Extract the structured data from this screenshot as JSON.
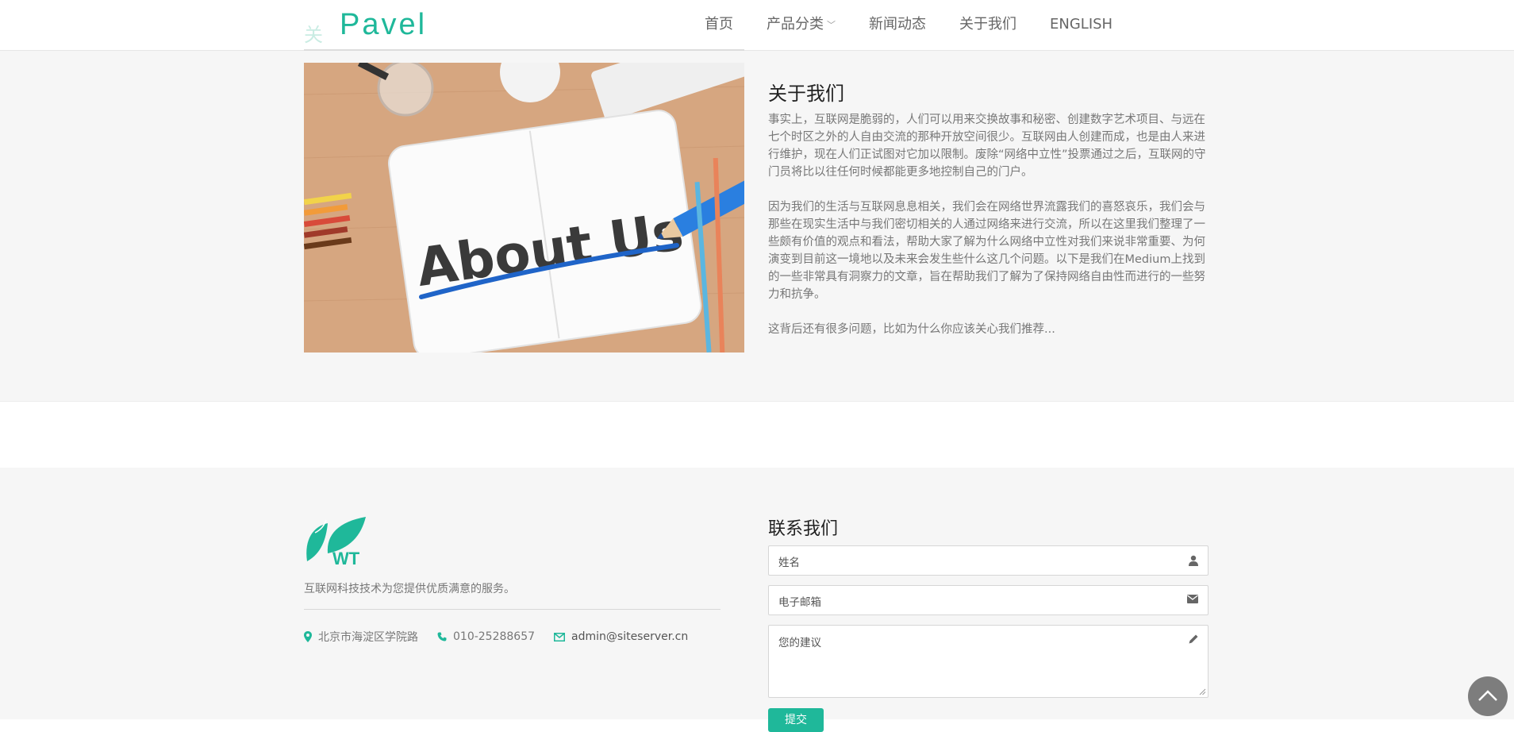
{
  "header": {
    "logo_text": "Pavel",
    "ghost_text": "关",
    "nav": [
      {
        "label": "首页"
      },
      {
        "label": "产品分类",
        "has_dropdown": true
      },
      {
        "label": "新闻动态"
      },
      {
        "label": "关于我们"
      },
      {
        "label": "ENGLISH"
      }
    ]
  },
  "about": {
    "image_text": "About Us",
    "title": "关于我们",
    "paragraphs": [
      "事实上，互联网是脆弱的，人们可以用来交换故事和秘密、创建数字艺术项目、与远在七个时区之外的人自由交流的那种开放空间很少。互联网由人创建而成，也是由人来进行维护，现在人们正试图对它加以限制。废除“网络中立性”投票通过之后，互联网的守门员将比以往任何时候都能更多地控制自己的门户。",
      "因为我们的生活与互联网息息相关，我们会在网络世界流露我们的喜怒哀乐，我们会与那些在现实生活中与我们密切相关的人通过网络来进行交流，所以在这里我们整理了一些颇有价值的观点和看法，帮助大家了解为什么网络中立性对我们来说非常重要、为何演变到目前这一境地以及未来会发生些什么这几个问题。以下是我们在Medium上找到的一些非常具有洞察力的文章，旨在帮助我们了解为了保持网络自由性而进行的一些努力和抗争。",
      "这背后还有很多问题，比如为什么你应该关心我们推荐..."
    ]
  },
  "footer": {
    "logo_text": "WT",
    "tagline": "互联网科技技术为您提供优质满意的服务。",
    "address": "北京市海淀区学院路",
    "phone": "010-25288657",
    "email": "admin@siteserver.cn",
    "form": {
      "title": "联系我们",
      "name_placeholder": "姓名",
      "email_placeholder": "电子邮箱",
      "message_placeholder": "您的建议",
      "submit_label": "提交"
    }
  },
  "colors": {
    "accent": "#1fb89a",
    "background_section": "#f6f6f6"
  },
  "icons": [
    "user-icon",
    "envelope-icon",
    "pencil-icon",
    "map-marker-icon",
    "phone-icon",
    "chevron-up-icon"
  ]
}
